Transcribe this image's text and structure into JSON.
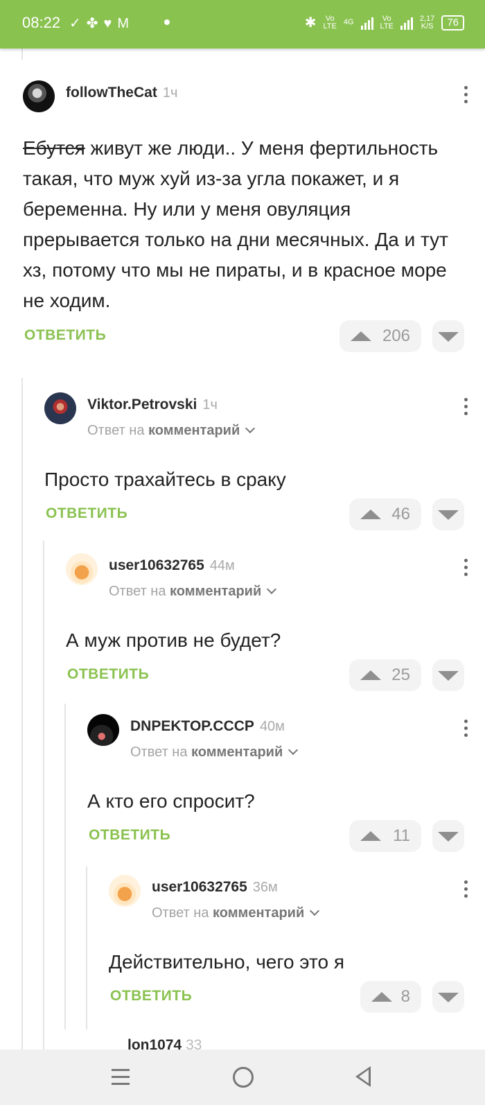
{
  "status_bar": {
    "time": "08:22",
    "notification_icons": [
      "check-circle-icon",
      "fan-icon",
      "health-icon",
      "gmail-icon",
      "dot-icon"
    ],
    "volte1": "Vo LTE",
    "net_type": "4G",
    "volte2": "Vo LTE",
    "speed": "2,17 K/S",
    "battery": "76"
  },
  "comments": [
    {
      "user": "followTheCat",
      "time": "1ч",
      "reply_prefix": "",
      "reply_target": "",
      "text_struck": "Ебутся",
      "text": " живут же люди.. У меня фертильность такая, что муж хуй из-за угла покажет, и я беременна. Ну или у меня овуляция прерывается только на дни месячных. Да и тут хз, потому что мы не пираты, и в красное море не ходим.",
      "reply_label": "ОТВЕТИТЬ",
      "votes": "206"
    },
    {
      "user": "Viktor.Petrovski",
      "time": "1ч",
      "reply_prefix": "Ответ на",
      "reply_target": "комментарий",
      "text": "Просто трахайтесь в сраку",
      "reply_label": "ОТВЕТИТЬ",
      "votes": "46"
    },
    {
      "user": "user10632765",
      "time": "44м",
      "reply_prefix": "Ответ на",
      "reply_target": "комментарий",
      "text": "А муж против не будет?",
      "reply_label": "ОТВЕТИТЬ",
      "votes": "25"
    },
    {
      "user": "DNPEKTOP.CCCP",
      "time": "40м",
      "reply_prefix": "Ответ на",
      "reply_target": "комментарий",
      "text": "А кто его спросит?",
      "reply_label": "ОТВЕТИТЬ",
      "votes": "11"
    },
    {
      "user": "user10632765",
      "time": "36м",
      "reply_prefix": "Ответ на",
      "reply_target": "комментарий",
      "text": "Действительно, чего это я",
      "reply_label": "ОТВЕТИТЬ",
      "votes": "8"
    }
  ],
  "peek_comment": {
    "user": "lon1074",
    "time": "33"
  },
  "colors": {
    "accent": "#8ac250",
    "status_bar": "#8ac250",
    "vote_bg": "#f3f3f3"
  }
}
